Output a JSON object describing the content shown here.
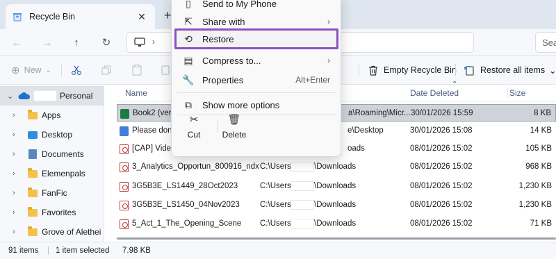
{
  "tab": {
    "title": "Recycle Bin",
    "close": "✕",
    "new_tab": "+"
  },
  "address": {
    "search_placeholder": "Sea"
  },
  "toolbar": {
    "new_label": "New",
    "empty_label": "Empty Recycle Bin",
    "restore_all_label": "Restore all items"
  },
  "sidebar": {
    "items": [
      {
        "label": "Personal",
        "icon": "cloud-icon"
      },
      {
        "label": "Apps"
      },
      {
        "label": "Desktop"
      },
      {
        "label": "Documents"
      },
      {
        "label": "Elemenpals"
      },
      {
        "label": "FanFic"
      },
      {
        "label": "Favorites"
      },
      {
        "label": "Grove of Alethei"
      }
    ]
  },
  "columns": {
    "name": "Name",
    "date_deleted": "Date Deleted",
    "size": "Size"
  },
  "files": [
    {
      "name": "Book2 (versi",
      "location": "a\\Roaming\\Micr...",
      "date": "30/01/2026 15:59",
      "size": "8 KB"
    },
    {
      "name": "Please don't",
      "location": "e\\Desktop",
      "date": "30/01/2026 15:08",
      "size": "14 KB"
    },
    {
      "name": "[CAP] Video",
      "location": "oads",
      "date": "08/01/2026 15:02",
      "size": "105 KB"
    },
    {
      "name": "3_Analytics_Opportun_800916_ndx",
      "location_prefix": "C:\\Users\\",
      "location_suffix": "\\Downloads",
      "date": "08/01/2026 15:02",
      "size": "968 KB"
    },
    {
      "name": "3G5B3E_LS1449_28Oct2023",
      "location_prefix": "C:\\Users\\",
      "location_suffix": "\\Downloads",
      "date": "08/01/2026 15:02",
      "size": "1,230 KB"
    },
    {
      "name": "3G5B3E_LS1450_04Nov2023",
      "location_prefix": "C:\\Users\\",
      "location_suffix": "\\Downloads",
      "date": "08/01/2026 15:02",
      "size": "1,230 KB"
    },
    {
      "name": "5_Act_1_The_Opening_Scene",
      "location_prefix": "C:\\Users\\",
      "location_suffix": "\\Downloads",
      "date": "08/01/2026 15:02",
      "size": "71 KB"
    }
  ],
  "status": {
    "count": "91 items",
    "selected": "1 item selected",
    "size": "7.98 KB"
  },
  "context_menu": {
    "send_phone": "Send to My Phone",
    "share": "Share with",
    "restore": "Restore",
    "compress": "Compress to...",
    "properties": "Properties",
    "properties_shortcut": "Alt+Enter",
    "more_options": "Show more options",
    "cut": "Cut",
    "delete": "Delete"
  },
  "colors": {
    "highlight": "#8b4fc1",
    "selection": "#cfd3d9"
  }
}
